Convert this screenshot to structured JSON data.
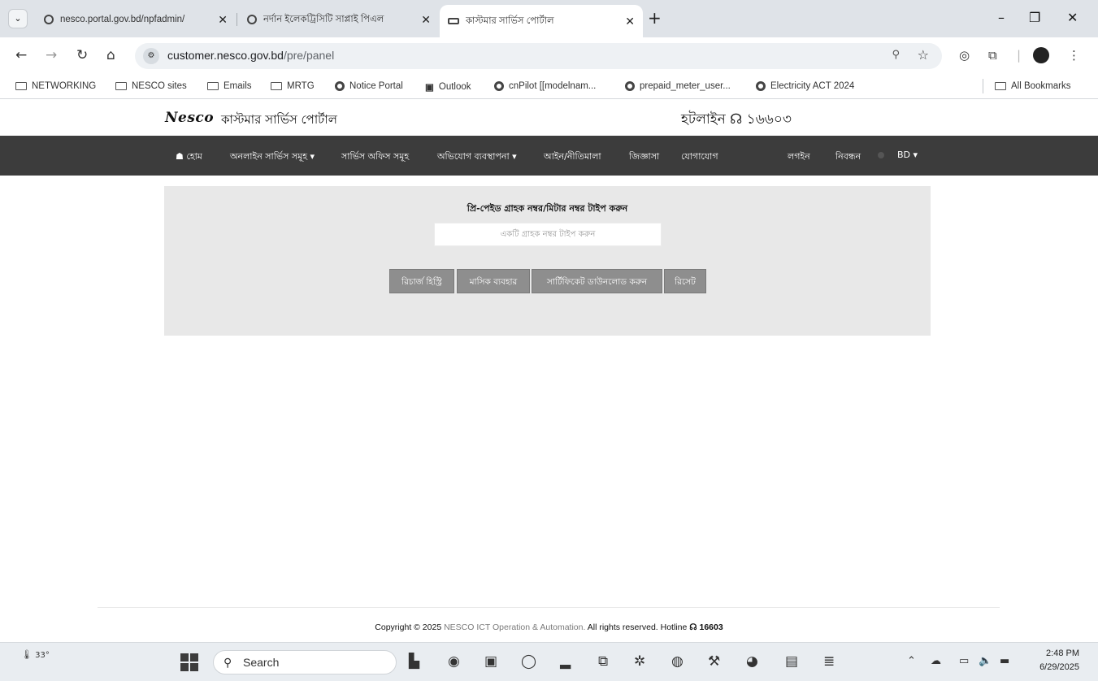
{
  "browser": {
    "tabs": [
      {
        "title": "nesco.portal.gov.bd/npfadmin/",
        "favicon": "globe-icon"
      },
      {
        "title": "নর্দান ইলেকট্রিসিটি সাপ্লাই পিএল",
        "favicon": "globe-icon"
      },
      {
        "title": "কাস্টমার সার্ভিস পোর্টাল",
        "favicon": "page-icon"
      }
    ],
    "url_host": "customer.nesco.gov.bd",
    "url_path": "/pre/panel",
    "bookmarks": [
      {
        "label": "NETWORKING",
        "icon": "folder-icon"
      },
      {
        "label": "NESCO sites",
        "icon": "folder-icon"
      },
      {
        "label": "Emails",
        "icon": "folder-icon"
      },
      {
        "label": "MRTG",
        "icon": "folder-icon"
      },
      {
        "label": "Notice Portal",
        "icon": "globe-icon"
      },
      {
        "label": "Outlook",
        "icon": "outlook-icon"
      },
      {
        "label": "cnPilot [[modelnam...",
        "icon": "globe-icon"
      },
      {
        "label": "prepaid_meter_user...",
        "icon": "globe-icon"
      },
      {
        "label": "Electricity ACT 2024",
        "icon": "globe-icon"
      },
      {
        "label": "All Bookmarks",
        "icon": "folder-icon"
      }
    ]
  },
  "site": {
    "logo": "Nesco",
    "portal_title": "কাস্টমার সার্ভিস পোর্টাল",
    "hotline": "হটলাইন ☊ ১৬৬০৩",
    "nav": {
      "home": "☗ হোম",
      "online_services": "অনলাইন সার্ভিস সমূহ ▾",
      "service_offices": "সার্ভিস অফিস সমূহ",
      "complaints": "অভিযোগ ব্যবস্থাপনা ▾",
      "laws": "আইন/নীতিমালা",
      "inquiry": "জিজ্ঞাসা",
      "contact": "যোগাযোগ",
      "login": "লগইন",
      "register": "নিবন্ধন",
      "language": "BD ▾"
    },
    "panel": {
      "label": "প্রি-পেইড গ্রাহক নম্বর/মিটার নম্বর টাইপ করুন",
      "input_placeholder": "একটি গ্রাহক নম্বর টাইপ করুন",
      "buttons": {
        "recharge_history": "রিচার্জ হিস্ট্রি",
        "monthly_usage": "মাসিক ব্যবহার",
        "certificate_download": "সার্টিফিকেট ডাউনলোড করুন",
        "reset": "রিসেট"
      }
    },
    "footer": {
      "prefix": "Copyright © 2025",
      "brand": "NESCO ICT Operation & Automation.",
      "rights": "All rights reserved. Hotline",
      "hotline": "☊ 16603"
    }
  },
  "taskbar": {
    "weather": "33°",
    "search_label": "Search",
    "time": "2:48 PM",
    "date": "6/29/2025"
  }
}
